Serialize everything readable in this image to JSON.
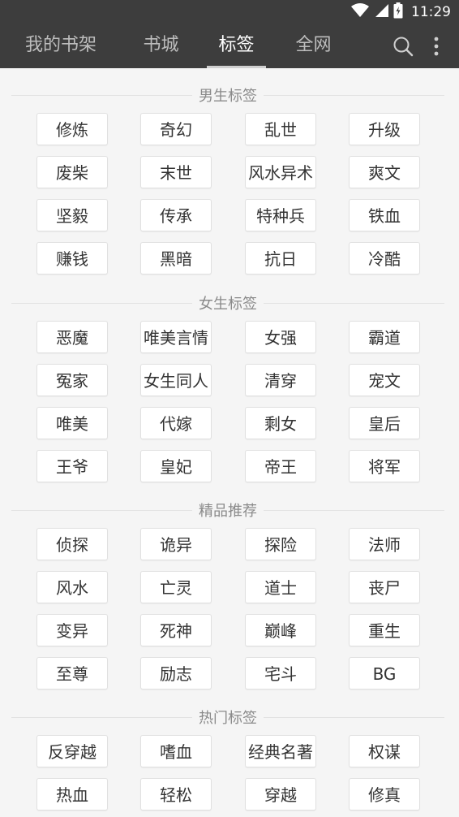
{
  "status_bar": {
    "time": "11:29",
    "icons": [
      "wifi-icon",
      "signal-icon",
      "battery-icon"
    ]
  },
  "nav": {
    "tabs": [
      {
        "label": "我的书架",
        "active": false
      },
      {
        "label": "书城",
        "active": false
      },
      {
        "label": "标签",
        "active": true
      },
      {
        "label": "全网",
        "active": false
      }
    ],
    "icons": [
      "search-icon",
      "more-vertical-icon"
    ]
  },
  "colors": {
    "bar_bg": "#3d3d3d",
    "page_bg": "#f5f5f5",
    "tag_bg": "#ffffff",
    "tag_text": "#333333",
    "section_text": "#8a8a8a"
  },
  "sections": [
    {
      "title": "男生标签",
      "tags": [
        "修炼",
        "奇幻",
        "乱世",
        "升级",
        "废柴",
        "末世",
        "风水异术",
        "爽文",
        "坚毅",
        "传承",
        "特种兵",
        "铁血",
        "赚钱",
        "黑暗",
        "抗日",
        "冷酷"
      ]
    },
    {
      "title": "女生标签",
      "tags": [
        "恶魔",
        "唯美言情",
        "女强",
        "霸道",
        "冤家",
        "女生同人",
        "清穿",
        "宠文",
        "唯美",
        "代嫁",
        "剩女",
        "皇后",
        "王爷",
        "皇妃",
        "帝王",
        "将军"
      ]
    },
    {
      "title": "精品推荐",
      "tags": [
        "侦探",
        "诡异",
        "探险",
        "法师",
        "风水",
        "亡灵",
        "道士",
        "丧尸",
        "变异",
        "死神",
        "巅峰",
        "重生",
        "至尊",
        "励志",
        "宅斗",
        "BG"
      ]
    },
    {
      "title": "热门标签",
      "tags": [
        "反穿越",
        "嗜血",
        "经典名著",
        "权谋",
        "热血",
        "轻松",
        "穿越",
        "修真"
      ]
    }
  ]
}
